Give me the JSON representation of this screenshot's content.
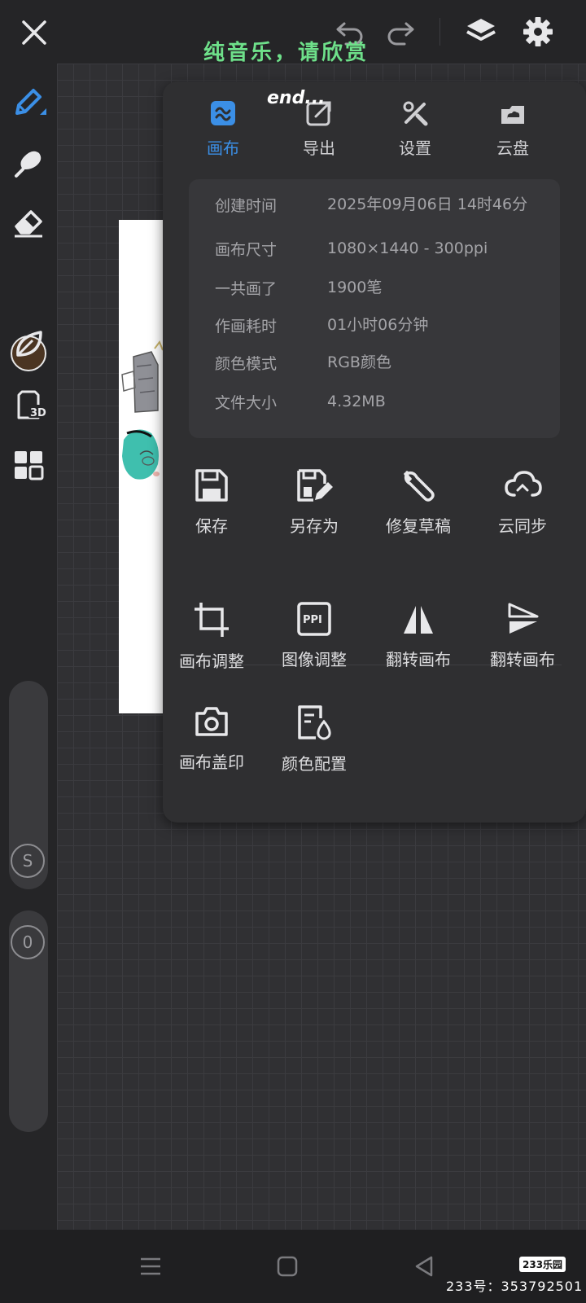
{
  "topbar": {
    "overlay_text": "纯音乐，请欣赏",
    "end_text": "end..."
  },
  "panel": {
    "tabs": [
      {
        "label": "画布",
        "icon": "canvas-icon",
        "active": true
      },
      {
        "label": "导出",
        "icon": "export-icon",
        "active": false
      },
      {
        "label": "设置",
        "icon": "settings-tools-icon",
        "active": false
      },
      {
        "label": "云盘",
        "icon": "cloud-drive-icon",
        "active": false
      }
    ],
    "info": [
      {
        "key": "创建时间",
        "value": "2025年09月06日 14时46分"
      },
      {
        "key": "画布尺寸",
        "value": "1080×1440 - 300ppi"
      },
      {
        "key": "一共画了",
        "value": "1900笔"
      },
      {
        "key": "作画耗时",
        "value": "01小时06分钟"
      },
      {
        "key": "颜色模式",
        "value": "RGB颜色"
      },
      {
        "key": "文件大小",
        "value": "4.32MB"
      }
    ],
    "actions_row1": [
      {
        "label": "保存",
        "icon": "save-icon"
      },
      {
        "label": "另存为",
        "icon": "save-as-icon"
      },
      {
        "label": "修复草稿",
        "icon": "wrench-icon"
      },
      {
        "label": "云同步",
        "icon": "cloud-sync-icon"
      }
    ],
    "actions_row2": [
      {
        "label": "画布调整",
        "icon": "crop-icon"
      },
      {
        "label": "图像调整",
        "icon": "ppi-icon"
      },
      {
        "label": "翻转画布",
        "icon": "flip-horizontal-icon"
      },
      {
        "label": "翻转画布",
        "icon": "flip-vertical-icon"
      }
    ],
    "actions_row3": [
      {
        "label": "画布盖印",
        "icon": "camera-icon"
      },
      {
        "label": "颜色配置",
        "icon": "color-config-icon"
      }
    ]
  },
  "leftbar": {
    "brush_color": "#4b3522",
    "stabilizer_label": "S",
    "opacity_value": "0"
  },
  "accent_color": "#3b8fe6",
  "watermark": {
    "logo": "233乐园",
    "id_text": "233号：353792501"
  }
}
